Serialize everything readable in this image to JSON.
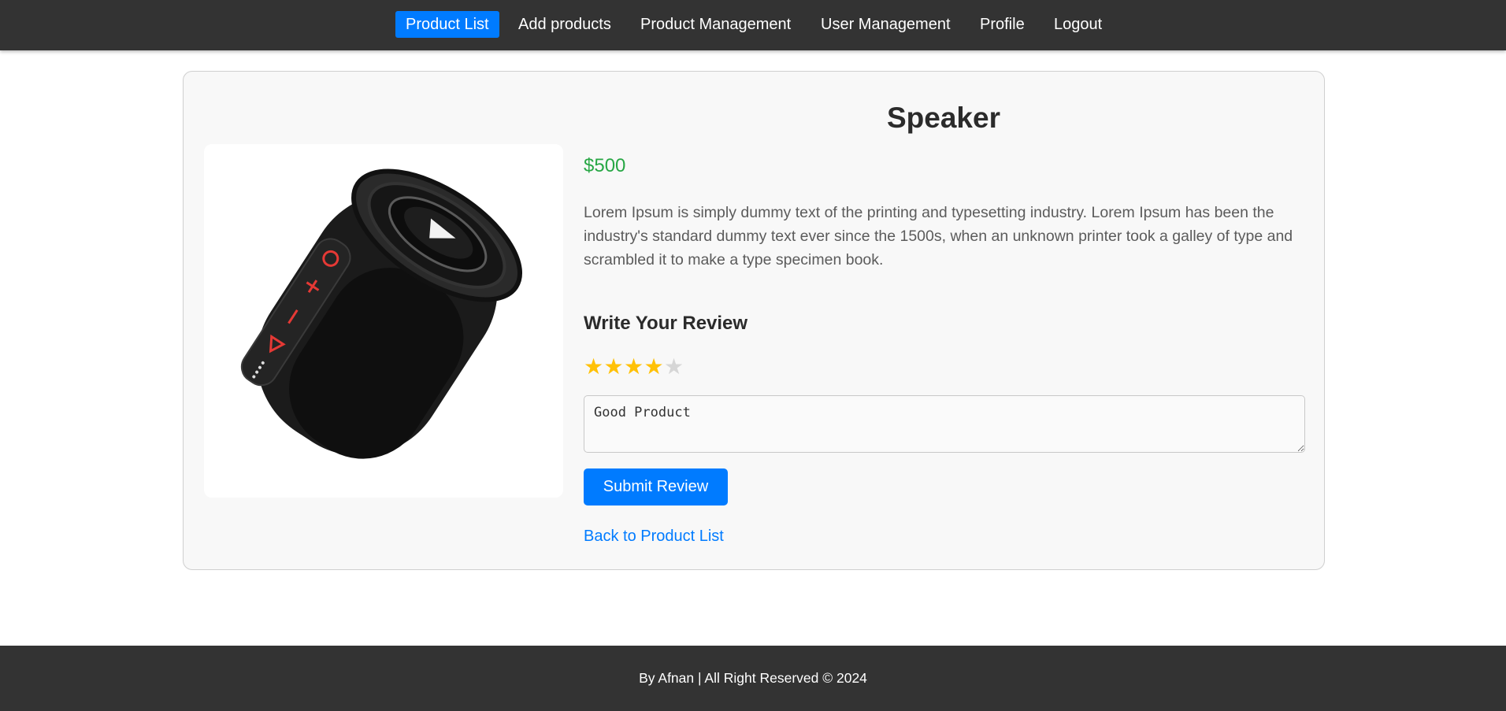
{
  "navbar": {
    "items": [
      {
        "label": "Product List",
        "active": true
      },
      {
        "label": "Add products",
        "active": false
      },
      {
        "label": "Product Management",
        "active": false
      },
      {
        "label": "User Management",
        "active": false
      },
      {
        "label": "Profile",
        "active": false
      },
      {
        "label": "Logout",
        "active": false
      }
    ],
    "active_color": "#007bff",
    "background": "#333333"
  },
  "product": {
    "name": "Speaker",
    "price": "$500",
    "description": "Lorem Ipsum is simply dummy text of the printing and typesetting industry. Lorem Ipsum has been the industry's standard dummy text ever since the 1500s, when an unknown printer took a galley of type and scrambled it to make a type specimen book.",
    "image_icon": "bluetooth-speaker-image",
    "price_color": "#28a745"
  },
  "review": {
    "heading": "Write Your Review",
    "rating": 4,
    "max_rating": 5,
    "star_glyph": "★",
    "star_color": "#ffc107",
    "text_value": "Good Product",
    "submit_label": "Submit Review"
  },
  "links": {
    "back_label": "Back to Product List"
  },
  "footer": {
    "text": "By Afnan | All Right Reserved © 2024"
  }
}
